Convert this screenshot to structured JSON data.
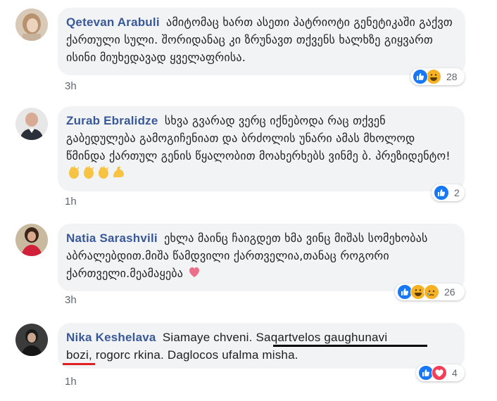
{
  "comments": [
    {
      "author": "Qetevan Arabuli",
      "text": "ამიტომაც ხართ ასეთი პატრიოტი გენეტიკაში გაქვთ ქართული სული. შორიდანაც კი ზრუნავთ თქვენს ხალხზე გიყვართ ისინი მიუხედავად ყველაფრისა.",
      "time": "3h",
      "reaction_count": "28",
      "reactions": [
        "like-icon",
        "haha-icon"
      ]
    },
    {
      "author": "Zurab Ebralidze",
      "text": "სხვა გვარად ვერც იქნებოდა რაც თქვენ გაბედულება გამოგიჩენიათ და ბრძოლის უნარი ამას მხოლოდ წმინდა ქართულ გენის წყალობით მოახერხებს ვინმე ბ. პრეზიდენტო!",
      "time": "1h",
      "reaction_count": "2",
      "reactions": [
        "like-icon"
      ]
    },
    {
      "author": "Natia Sarashvili",
      "text": "ეხლა მაინც ჩაიგდეთ ხმა ვინც მიშას სომეხობას აბრალებდით.მიშა წამდვილი ქართველია,თანაც როგორი ქართველი.მეამაყება",
      "time": "3h",
      "reaction_count": "26",
      "reactions": [
        "like-icon",
        "haha-icon",
        "sad-icon"
      ]
    },
    {
      "author": "Nika Keshelava",
      "text_a": "Siamaye chveni. ",
      "text_b": "Saqartvelos gaughunavi",
      "text_c": "bozi",
      "text_d": ", rogorc rkina. Daglocos ufalma misha.",
      "time": "1h",
      "reaction_count": "4",
      "reactions": [
        "like-icon",
        "love-icon"
      ]
    }
  ],
  "colors": {
    "author": "#385898",
    "bubble": "#f2f3f5",
    "like": "#1877f2",
    "haha": "#f7b125",
    "love": "#f33e58",
    "underline_black": "#000000",
    "underline_red": "#e02020"
  }
}
